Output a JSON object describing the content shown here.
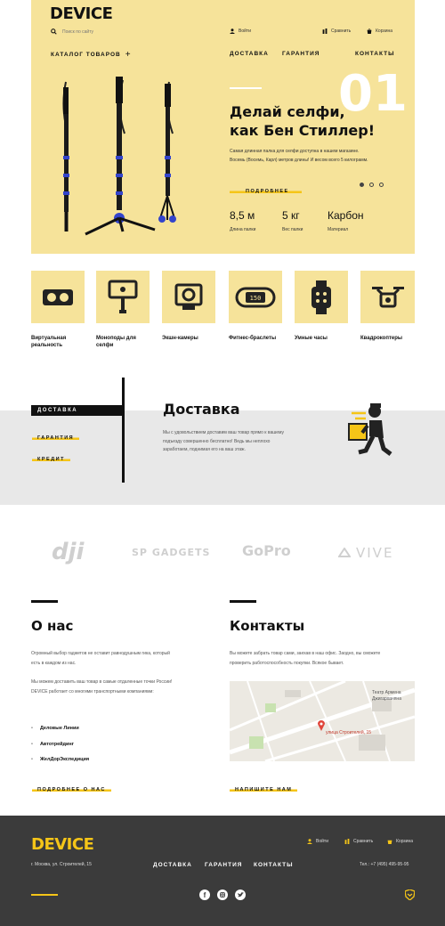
{
  "header": {
    "logo": "DEVICE",
    "search_placeholder": "Поиск по сайту",
    "login": "Войти",
    "compare": "Сравнить",
    "cart": "Корзина",
    "catalog": "КАТАЛОГ ТОВАРОВ",
    "nav": [
      "ДОСТАВКА",
      "ГАРАНТИЯ",
      "КОНТАКТЫ"
    ]
  },
  "hero": {
    "number": "01",
    "title_line1": "Делай селфи,",
    "title_line2": "как Бен Стиллер!",
    "desc_line1": "Самая длинная палка для селфи доступна в нашем магазине.",
    "desc_line2": "Восемь (Восемь, Карл) метров длины! И весом всего 5 килограмм.",
    "more": "ПОДРОБНЕЕ",
    "stats": [
      {
        "value": "8,5 м",
        "label": "Длина палки"
      },
      {
        "value": "5 кг",
        "label": "Вес палки"
      },
      {
        "value": "Карбон",
        "label": "Материал"
      }
    ]
  },
  "categories": [
    {
      "label": "Виртуальная реальность",
      "icon": "vr-headset-icon"
    },
    {
      "label": "Моноподы для селфи",
      "icon": "monopod-icon"
    },
    {
      "label": "Экшн-камеры",
      "icon": "action-camera-icon"
    },
    {
      "label": "Фитнес-браслеты",
      "icon": "fitness-band-icon"
    },
    {
      "label": "Умные часы",
      "icon": "smartwatch-icon"
    },
    {
      "label": "Квадрокоптеры",
      "icon": "drone-icon"
    }
  ],
  "services": {
    "tabs": [
      "ДОСТАВКА",
      "ГАРАНТИЯ",
      "КРЕДИТ"
    ],
    "title": "Доставка",
    "desc_line1": "Мы с удовольствием доставим ваш товар прямо к вашему",
    "desc_line2": "подъезду совершенно бесплатно! Ведь мы неплохо",
    "desc_line3": "заработаем, поднимая его на ваш этаж."
  },
  "brands": [
    "dji",
    "SP GADGETS",
    "GoPro",
    "VIVE"
  ],
  "about": {
    "title": "О нас",
    "p1_line1": "Огромный выбор гаджетов не оставит равнодушным гика, который",
    "p1_line2": "есть в каждом из нас.",
    "p2_line1": "Мы можем доставить ваш товар в самые отдаленные точки России!",
    "p2_line2": "DEVICE работает со многими транспортными компаниями:",
    "list": [
      "Деловые Линии",
      "Автотрейдинг",
      "ЖелДорЭкспедиция"
    ],
    "more": "ПОДРОБНЕЕ О НАС"
  },
  "contacts": {
    "title": "Контакты",
    "p_line1": "Вы можете забрать товар сами, заехав в наш офис. Заодно, вы сможете",
    "p_line2": "проверить работоспособность покупки. Всякое бывает.",
    "map_label": "улица Строителей, 15",
    "map_theatre_line1": "Театр Армена",
    "map_theatre_line2": "Джигарханяна",
    "write": "НАПИШИТЕ НАМ"
  },
  "footer": {
    "logo": "DEVICE",
    "address": "г. Москва, ул. Строителей, 15",
    "nav": [
      "ДОСТАВКА",
      "ГАРАНТИЯ",
      "КОНТАКТЫ"
    ],
    "login": "Войти",
    "compare": "Сравнить",
    "cart": "Корзина",
    "phone": "Тел.: +7 (495) 495-95-95"
  },
  "colors": {
    "accent": "#f5c518",
    "hero_bg": "#f6e39a",
    "footer_bg": "#3b3b3b"
  }
}
